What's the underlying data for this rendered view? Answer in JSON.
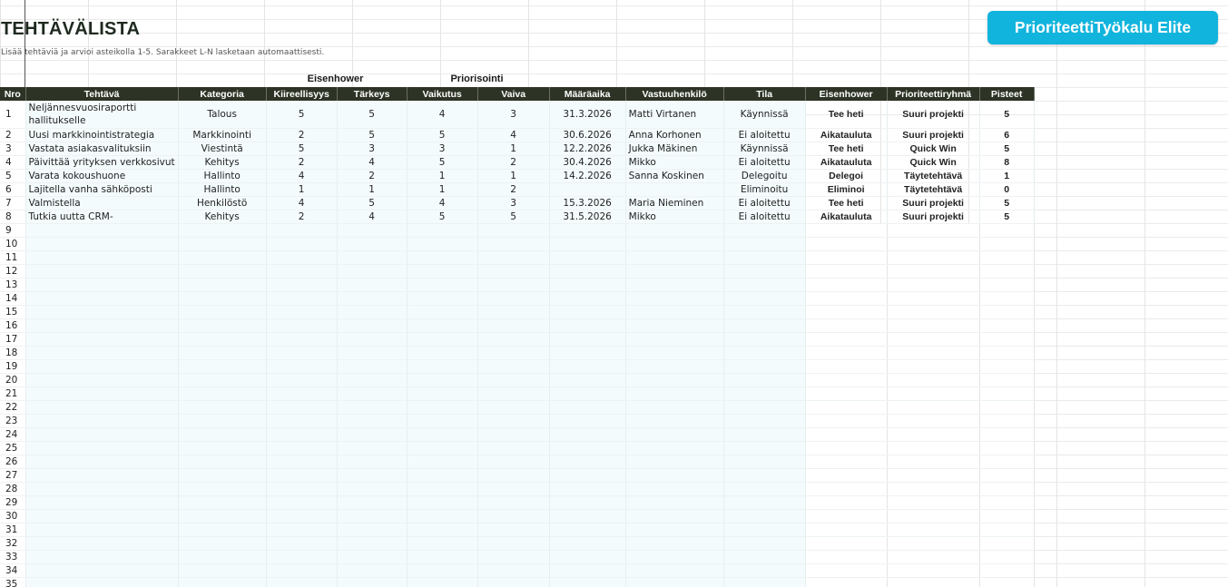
{
  "title": "TEHTÄVÄLISTA",
  "subtitle": "Lisää tehtäviä ja arvioi asteikolla 1-5. Sarakkeet L-N lasketaan automaattisesti.",
  "brand_button": "PrioriteettiTyökalu Elite",
  "group_headers": {
    "eisenhower": "Eisenhower",
    "priorisointi": "Priorisointi"
  },
  "columns": [
    "Nro",
    "Tehtävä",
    "Kategoria",
    "Kiireellisyys",
    "Tärkeys",
    "Vaikutus",
    "Vaiva",
    "Määräaika",
    "Vastuuhenkilö",
    "Tila",
    "Eisenhower",
    "Prioriteettiryhmä",
    "Pisteet"
  ],
  "rows": [
    {
      "nro": "1",
      "tehtava": "Neljännesvuosiraportti hallitukselle",
      "kategoria": "Talous",
      "kiire": "5",
      "tarkeys": "5",
      "vaikutus": "4",
      "vaiva": "3",
      "maaraaika": "31.3.2026",
      "vastuu": "Matti Virtanen",
      "tila": "Käynnissä",
      "eisenhower": "Tee heti",
      "ryhma": "Suuri projekti",
      "pisteet": "5"
    },
    {
      "nro": "2",
      "tehtava": "Uusi markkinointistrategia",
      "kategoria": "Markkinointi",
      "kiire": "2",
      "tarkeys": "5",
      "vaikutus": "5",
      "vaiva": "4",
      "maaraaika": "30.6.2026",
      "vastuu": "Anna Korhonen",
      "tila": "Ei aloitettu",
      "eisenhower": "Aikatauluta",
      "ryhma": "Suuri projekti",
      "pisteet": "6"
    },
    {
      "nro": "3",
      "tehtava": "Vastata asiakasvalituksiin",
      "kategoria": "Viestintä",
      "kiire": "5",
      "tarkeys": "3",
      "vaikutus": "3",
      "vaiva": "1",
      "maaraaika": "12.2.2026",
      "vastuu": "Jukka Mäkinen",
      "tila": "Käynnissä",
      "eisenhower": "Tee heti",
      "ryhma": "Quick Win",
      "pisteet": "5"
    },
    {
      "nro": "4",
      "tehtava": "Päivittää yrityksen verkkosivut",
      "kategoria": "Kehitys",
      "kiire": "2",
      "tarkeys": "4",
      "vaikutus": "5",
      "vaiva": "2",
      "maaraaika": "30.4.2026",
      "vastuu": "Mikko",
      "tila": "Ei aloitettu",
      "eisenhower": "Aikatauluta",
      "ryhma": "Quick Win",
      "pisteet": "8"
    },
    {
      "nro": "5",
      "tehtava": "Varata kokoushuone",
      "kategoria": "Hallinto",
      "kiire": "4",
      "tarkeys": "2",
      "vaikutus": "1",
      "vaiva": "1",
      "maaraaika": "14.2.2026",
      "vastuu": "Sanna Koskinen",
      "tila": "Delegoitu",
      "eisenhower": "Delegoi",
      "ryhma": "Täytetehtävä",
      "pisteet": "1"
    },
    {
      "nro": "6",
      "tehtava": "Lajitella vanha sähköposti",
      "kategoria": "Hallinto",
      "kiire": "1",
      "tarkeys": "1",
      "vaikutus": "1",
      "vaiva": "2",
      "maaraaika": "",
      "vastuu": "",
      "tila": "Eliminoitu",
      "eisenhower": "Eliminoi",
      "ryhma": "Täytetehtävä",
      "pisteet": "0"
    },
    {
      "nro": "7",
      "tehtava": "Valmistella",
      "kategoria": "Henkilöstö",
      "kiire": "4",
      "tarkeys": "5",
      "vaikutus": "4",
      "vaiva": "3",
      "maaraaika": "15.3.2026",
      "vastuu": "Maria Nieminen",
      "tila": "Ei aloitettu",
      "eisenhower": "Tee heti",
      "ryhma": "Suuri projekti",
      "pisteet": "5"
    },
    {
      "nro": "8",
      "tehtava": "Tutkia uutta CRM-",
      "kategoria": "Kehitys",
      "kiire": "2",
      "tarkeys": "4",
      "vaikutus": "5",
      "vaiva": "5",
      "maaraaika": "31.5.2026",
      "vastuu": "Mikko",
      "tila": "Ei aloitettu",
      "eisenhower": "Aikatauluta",
      "ryhma": "Suuri projekti",
      "pisteet": "5"
    }
  ],
  "empty_row_numbers": [
    "9",
    "10",
    "11",
    "12",
    "13",
    "14",
    "15",
    "16",
    "17",
    "18",
    "19",
    "20",
    "21",
    "22",
    "23",
    "24",
    "25",
    "26",
    "27",
    "28",
    "29",
    "30",
    "31",
    "32",
    "33",
    "34",
    "35"
  ],
  "colors": {
    "header_bg": "#2d3325",
    "brand": "#11b4dd",
    "row_tint": "#f4fbfd"
  }
}
